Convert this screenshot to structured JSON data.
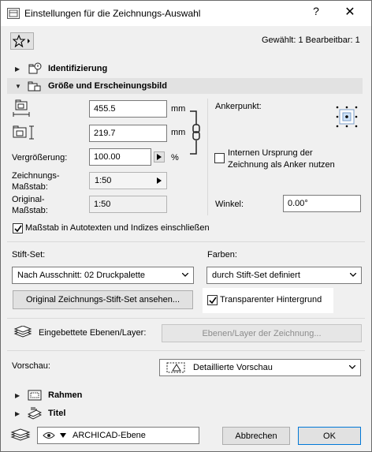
{
  "window": {
    "title": "Einstellungen für die Zeichnungs-Auswahl",
    "help_glyph": "?",
    "close_glyph": "✕"
  },
  "toolbar": {
    "selection_info": "Gewählt: 1 Bearbeitbar: 1"
  },
  "sections": {
    "identification": "Identifizierung",
    "size_appearance": "Größe und Erscheinungsbild",
    "frame": "Rahmen",
    "title": "Titel"
  },
  "size": {
    "width_value": "455.5",
    "width_unit": "mm",
    "height_value": "219.7",
    "height_unit": "mm",
    "magnification_label": "Vergrößerung:",
    "magnification_value": "100.00",
    "magnification_unit": "%",
    "drawing_scale_label": "Zeichnungs-\nMaßstab:",
    "drawing_scale_value": "1:50",
    "original_scale_label": "Original-\nMaßstab:",
    "original_scale_value": "1:50",
    "anchor_label": "Ankerpunkt:",
    "internal_origin_label": "Internen Ursprung der\nZeichnung als Anker nutzen",
    "angle_label": "Winkel:",
    "angle_value": "0.00°",
    "autotext_checkbox": "Maßstab in Autotexten und Indizes einschließen"
  },
  "pens": {
    "penset_label": "Stift-Set:",
    "penset_value": "Nach Ausschnitt: 02 Druckpalette",
    "colors_label": "Farben:",
    "colors_value": "durch Stift-Set definiert",
    "view_original_button": "Original Zeichnungs-Stift-Set ansehen...",
    "transparent_bg_label": "Transparenter Hintergrund"
  },
  "layers": {
    "label": "Eingebettete Ebenen/Layer:",
    "button": "Ebenen/Layer der Zeichnung..."
  },
  "preview": {
    "label": "Vorschau:",
    "value": "Detaillierte Vorschau"
  },
  "footer": {
    "layer_value": "ARCHICAD-Ebene",
    "cancel": "Abbrechen",
    "ok": "OK"
  }
}
